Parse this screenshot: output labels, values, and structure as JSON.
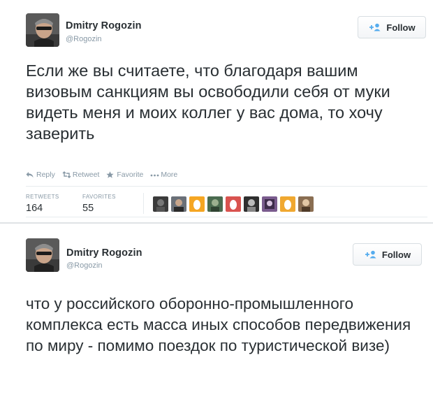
{
  "tweets": [
    {
      "user": {
        "name": "Dmitry Rogozin",
        "handle": "@Rogozin"
      },
      "follow_label": "Follow",
      "text": "Если же вы считаете, что благодаря вашим визовым санкциям вы освободили себя от муки видеть меня и моих коллег у вас дома, то хочу заверить",
      "actions": [
        {
          "icon": "reply-icon",
          "label": "Reply"
        },
        {
          "icon": "retweet-icon",
          "label": "Retweet"
        },
        {
          "icon": "star-icon",
          "label": "Favorite"
        },
        {
          "icon": "more-dots-icon",
          "label": "More"
        }
      ],
      "stats": {
        "retweets_label": "RETWEETS",
        "retweets": "164",
        "favorites_label": "FAVORITES",
        "favorites": "55"
      },
      "favoriter_avatars": [
        {
          "icon": "avatar-dark",
          "color": "#3b3b3b"
        },
        {
          "icon": "avatar-man",
          "color": "#6a7078"
        },
        {
          "icon": "avatar-egg",
          "color": "#f5a623"
        },
        {
          "icon": "avatar-green",
          "color": "#4a6b4f"
        },
        {
          "icon": "avatar-egg",
          "color": "#d9534f"
        },
        {
          "icon": "avatar-photo",
          "color": "#2f2f2f"
        },
        {
          "icon": "avatar-photo",
          "color": "#7a5c8e"
        },
        {
          "icon": "avatar-egg",
          "color": "#f0a830"
        },
        {
          "icon": "avatar-photo",
          "color": "#8a6e52"
        }
      ]
    },
    {
      "user": {
        "name": "Dmitry Rogozin",
        "handle": "@Rogozin"
      },
      "follow_label": "Follow",
      "text": "что у российского оборонно-промышленного комплекса есть масса иных способов передвижения по миру - помимо поездок по туристической визе)"
    }
  ],
  "colors": {
    "text": "#292f33",
    "muted": "#8899a6",
    "border": "#d8dee2",
    "follow_icon": "#55acee"
  }
}
